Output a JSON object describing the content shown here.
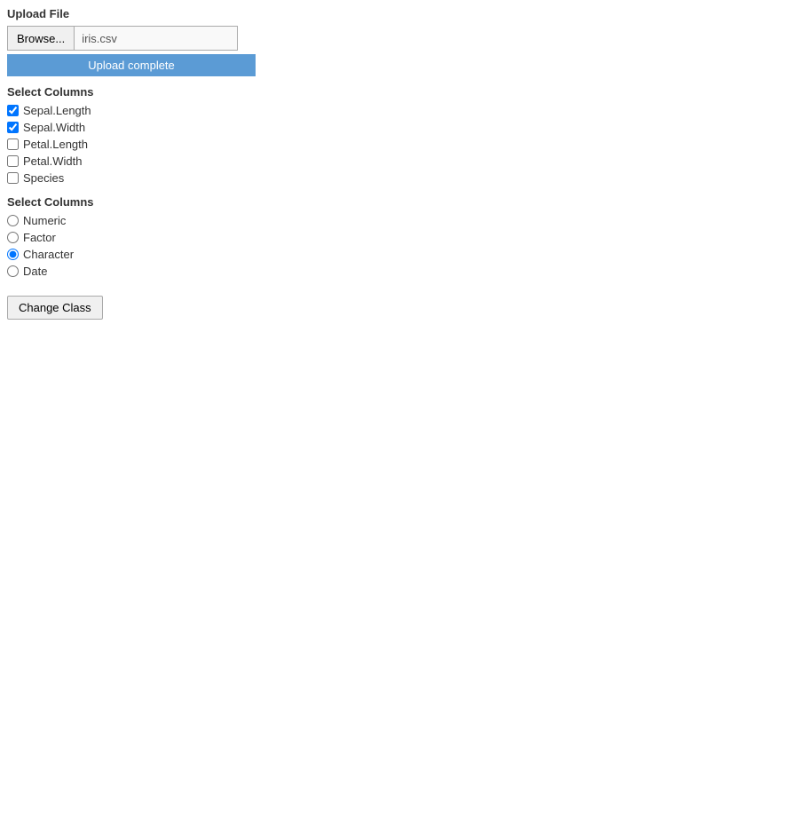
{
  "upload": {
    "section_title": "Upload File",
    "browse_label": "Browse...",
    "file_name": "iris.csv",
    "upload_status": "Upload complete"
  },
  "select_columns_checkboxes": {
    "section_title": "Select Columns",
    "columns": [
      {
        "label": "Sepal.Length",
        "checked": true
      },
      {
        "label": "Sepal.Width",
        "checked": true
      },
      {
        "label": "Petal.Length",
        "checked": false
      },
      {
        "label": "Petal.Width",
        "checked": false
      },
      {
        "label": "Species",
        "checked": false
      }
    ]
  },
  "select_columns_radio": {
    "section_title": "Select Columns",
    "options": [
      {
        "label": "Numeric",
        "checked": false
      },
      {
        "label": "Factor",
        "checked": false
      },
      {
        "label": "Character",
        "checked": true
      },
      {
        "label": "Date",
        "checked": false
      }
    ]
  },
  "change_class": {
    "button_label": "Change Class"
  }
}
